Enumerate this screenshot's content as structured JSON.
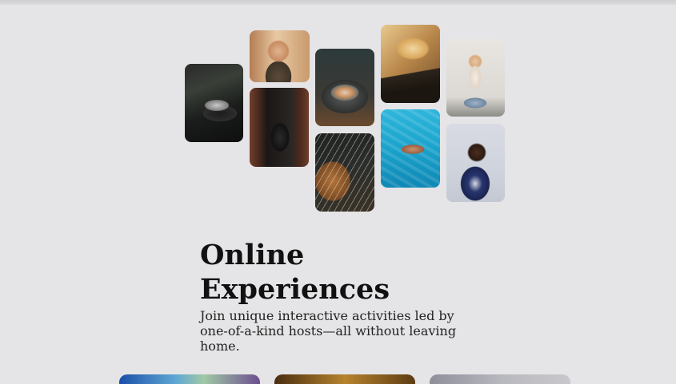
{
  "hero": {
    "title": "Online Experiences",
    "description": "Join unique interactive activities led by one-of-a-kind hosts—all without leaving home."
  },
  "collage": {
    "photos": [
      {
        "name": "cooking-photo"
      },
      {
        "name": "woman-cooking-photo"
      },
      {
        "name": "food-bowl-photo"
      },
      {
        "name": "piano-microphone-photo"
      },
      {
        "name": "yoga-photo"
      },
      {
        "name": "dancer-doorway-photo"
      },
      {
        "name": "guitar-photo"
      },
      {
        "name": "swimmer-photo"
      },
      {
        "name": "singer-photo"
      }
    ]
  },
  "colors": {
    "background": "#e5e4e6",
    "text": "#111111"
  }
}
